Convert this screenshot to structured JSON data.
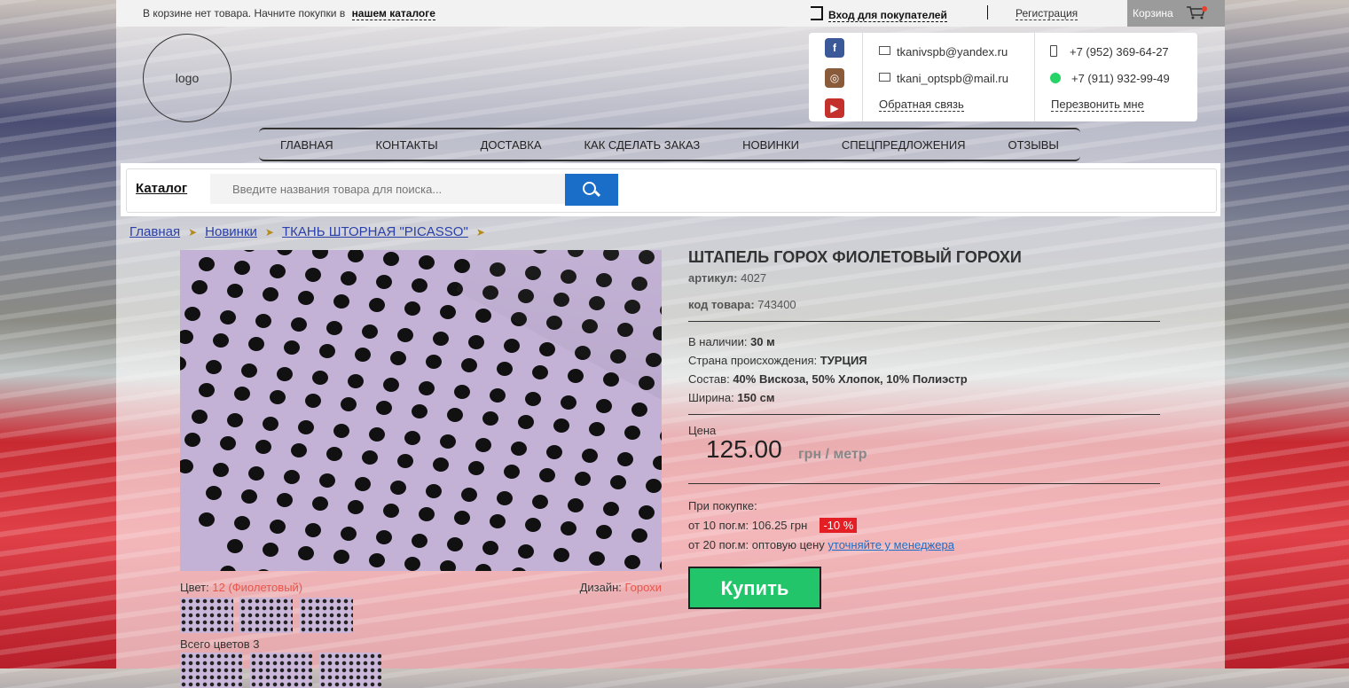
{
  "topbar": {
    "cart_empty_text": "В корзине нет товара. Начните покупки в",
    "catalog_link": "нашем каталоге",
    "login": "Вход для покупателей",
    "register": "Регистрация",
    "cart": "Корзина"
  },
  "logo": {
    "text": "logo"
  },
  "contacts": {
    "email1": "tkanivspb@yandex.ru",
    "email2": "tkani_optspb@mail.ru",
    "feedback": "Обратная связь",
    "phone1": "+7 (952) 369-64-27",
    "phone2": "+7 (911) 932-99-49",
    "callback": "Перезвонить мне"
  },
  "nav": {
    "items": [
      "ГЛАВНАЯ",
      "КОНТАКТЫ",
      "ДОСТАВКА",
      "КАК СДЕЛАТЬ ЗАКАЗ",
      "НОВИНКИ",
      "СПЕЦПРЕДЛОЖЕНИЯ",
      "ОТЗЫВЫ"
    ]
  },
  "search": {
    "catalog_label": "Каталог",
    "placeholder": "Введите названия товара для поиска..."
  },
  "breadcrumbs": [
    "Главная",
    "Новинки",
    "ТКАНЬ ШТОРНАЯ \"PICASSO\""
  ],
  "product": {
    "title": "ШТАПЕЛЬ ГОРОХ ФИОЛЕТОВЫЙ ГОРОХИ",
    "article_label": "артикул:",
    "article": "4027",
    "code_label": "код товара:",
    "code": "743400",
    "stock_label": "В наличии:",
    "stock": "30 м",
    "country_label": "Страна происхождения:",
    "country": "ТУРЦИЯ",
    "composition_label": "Состав:",
    "composition": "40% Вискоза, 50% Хлопок, 10% Полиэстр",
    "width_label": "Ширина:",
    "width": "150 см",
    "price_label": "Цена",
    "price": "125.00",
    "price_unit": "грн / метр",
    "bulk_title": "При покупке:",
    "bulk_10": "от 10 пог.м: 106.25 грн",
    "bulk_10_badge": "-10 %",
    "bulk_20": "от 20 пог.м: оптовую цену",
    "bulk_20_link": "уточняйте у менеджера",
    "buy": "Купить",
    "color_label": "Цвет:",
    "color_value": "12 (Фиолетовый)",
    "design_label": "Дизайн:",
    "design_value": "Горохи",
    "total_colors": "Всего цветов 3"
  },
  "colors": {
    "accent_red": "#e31e24",
    "buy_green": "#22c56a",
    "search_blue": "#1a6ec8",
    "fabric_lilac": "#c3b1d6"
  }
}
